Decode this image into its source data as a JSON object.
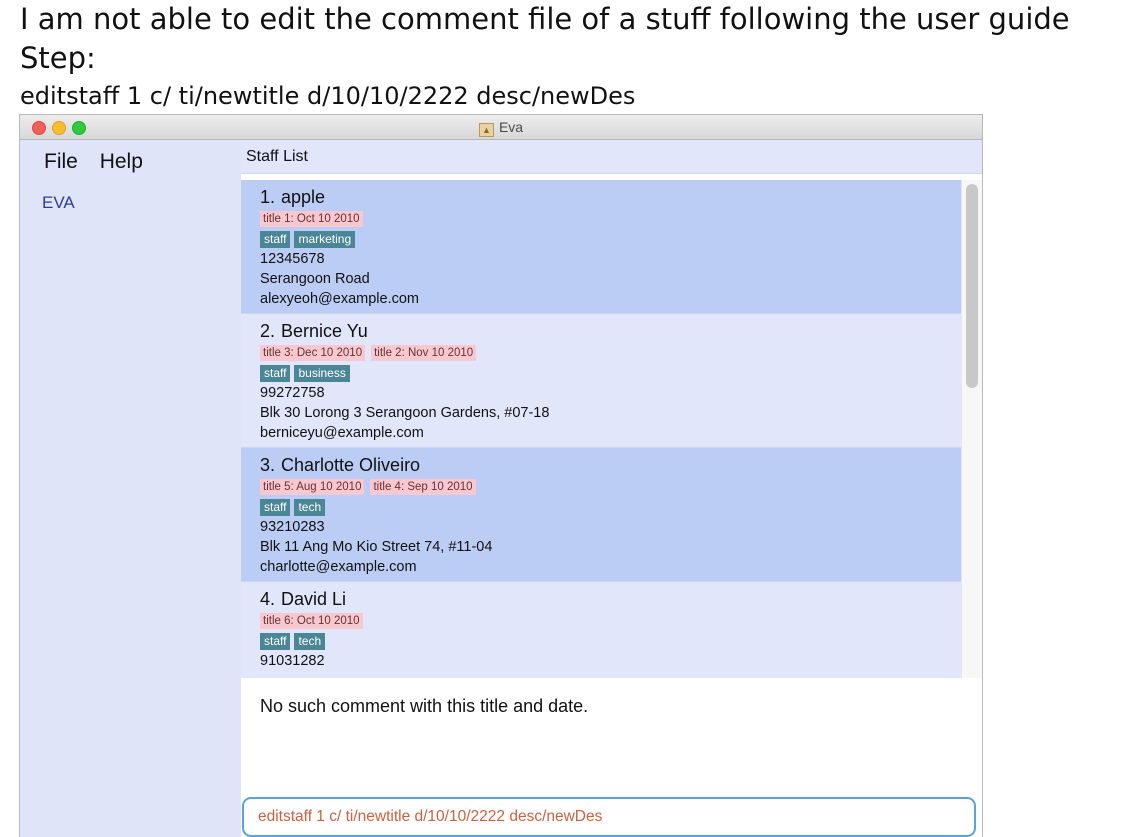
{
  "caption": {
    "line1": "I am not able to edit the comment file of a stuff following the user guide",
    "line2": "Step:",
    "line3": "editstaff 1 c/ ti/newtitle d/10/10/2222 desc/newDes"
  },
  "window": {
    "title": "Eva"
  },
  "menu": {
    "file": "File",
    "help": "Help"
  },
  "sidebar": {
    "link": "EVA"
  },
  "list": {
    "header": "Staff List",
    "cards": [
      {
        "index": "1.",
        "name": "apple",
        "comments": [
          "title 1: Oct 10 2010"
        ],
        "tags": [
          "staff",
          "marketing"
        ],
        "phone": "12345678",
        "address": "Serangoon Road",
        "email": "alexyeoh@example.com"
      },
      {
        "index": "2.",
        "name": "Bernice Yu",
        "comments": [
          "title 3: Dec 10 2010",
          "title 2: Nov 10 2010"
        ],
        "tags": [
          "staff",
          "business"
        ],
        "phone": "99272758",
        "address": "Blk 30 Lorong 3 Serangoon Gardens, #07-18",
        "email": "berniceyu@example.com"
      },
      {
        "index": "3.",
        "name": "Charlotte Oliveiro",
        "comments": [
          "title 5: Aug 10 2010",
          "title 4: Sep 10 2010"
        ],
        "tags": [
          "staff",
          "tech"
        ],
        "phone": "93210283",
        "address": "Blk 11 Ang Mo Kio Street 74, #11-04",
        "email": "charlotte@example.com"
      },
      {
        "index": "4.",
        "name": "David Li",
        "comments": [
          "title 6: Oct 10 2010"
        ],
        "tags": [
          "staff",
          "tech"
        ],
        "phone": "91031282",
        "address": "",
        "email": ""
      }
    ]
  },
  "result": {
    "message": "No such comment with this title and date."
  },
  "command": {
    "value": "editstaff 1 c/ ti/newtitle d/10/10/2222 desc/newDes"
  },
  "colors": {
    "selected_card": "#bccdf5",
    "comment_tag": "#f7c8d0",
    "staff_tag": "#4a8696",
    "command_text": "#d0603f",
    "command_border": "#5aa0e6"
  }
}
